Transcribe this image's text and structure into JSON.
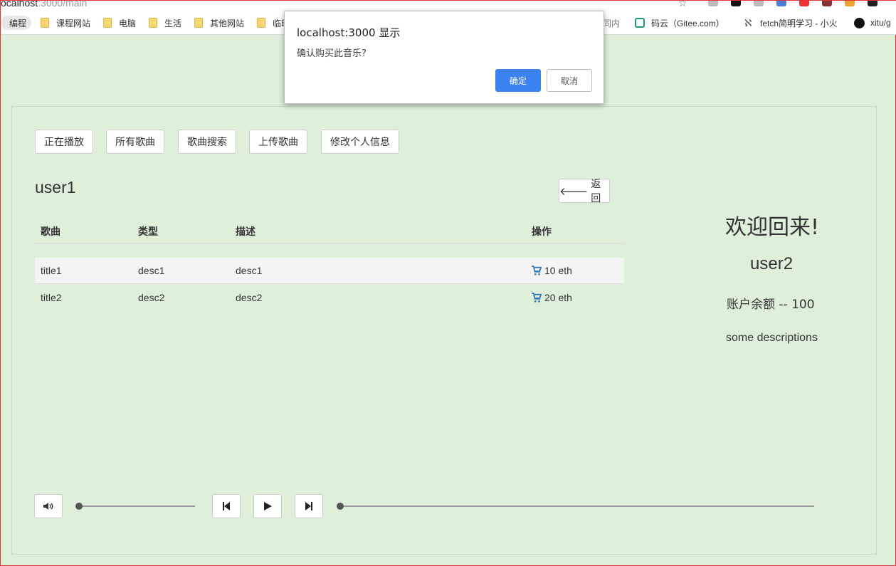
{
  "browser": {
    "url_host": "ocalhost",
    "url_path": ":3000/main",
    "bookmarks": [
      "编程",
      "课程网站",
      "电脑",
      "生活",
      "其他网站",
      "临时",
      "同内",
      "码云（Gitee.com）",
      "fetch简明学习 - 小火",
      "xitu/g"
    ]
  },
  "nav": {
    "now_playing": "正在播放",
    "all_songs": "所有歌曲",
    "search_songs": "歌曲搜索",
    "upload_song": "上传歌曲",
    "edit_profile": "修改个人信息"
  },
  "page": {
    "title": "user1",
    "back_label": "返回"
  },
  "table": {
    "headers": [
      "歌曲",
      "类型",
      "描述",
      "操作"
    ],
    "rows": [
      {
        "song": "title1",
        "type": "desc1",
        "desc": "desc1",
        "price": "10 eth"
      },
      {
        "song": "title2",
        "type": "desc2",
        "desc": "desc2",
        "price": "20 eth"
      }
    ]
  },
  "profile": {
    "welcome": "欢迎回来!",
    "username": "user2",
    "balance": "账户余额 -- 100",
    "description": "some descriptions"
  },
  "player": {
    "volume_level": 0,
    "progress": 0
  },
  "dialog": {
    "title": "localhost:3000 显示",
    "message": "确认购买此音乐?",
    "ok_label": "确定",
    "cancel_label": "取消"
  },
  "colors": {
    "page_bg": "#def0da",
    "primary_blue": "#3d82f1",
    "cart_blue": "#337ab7"
  }
}
